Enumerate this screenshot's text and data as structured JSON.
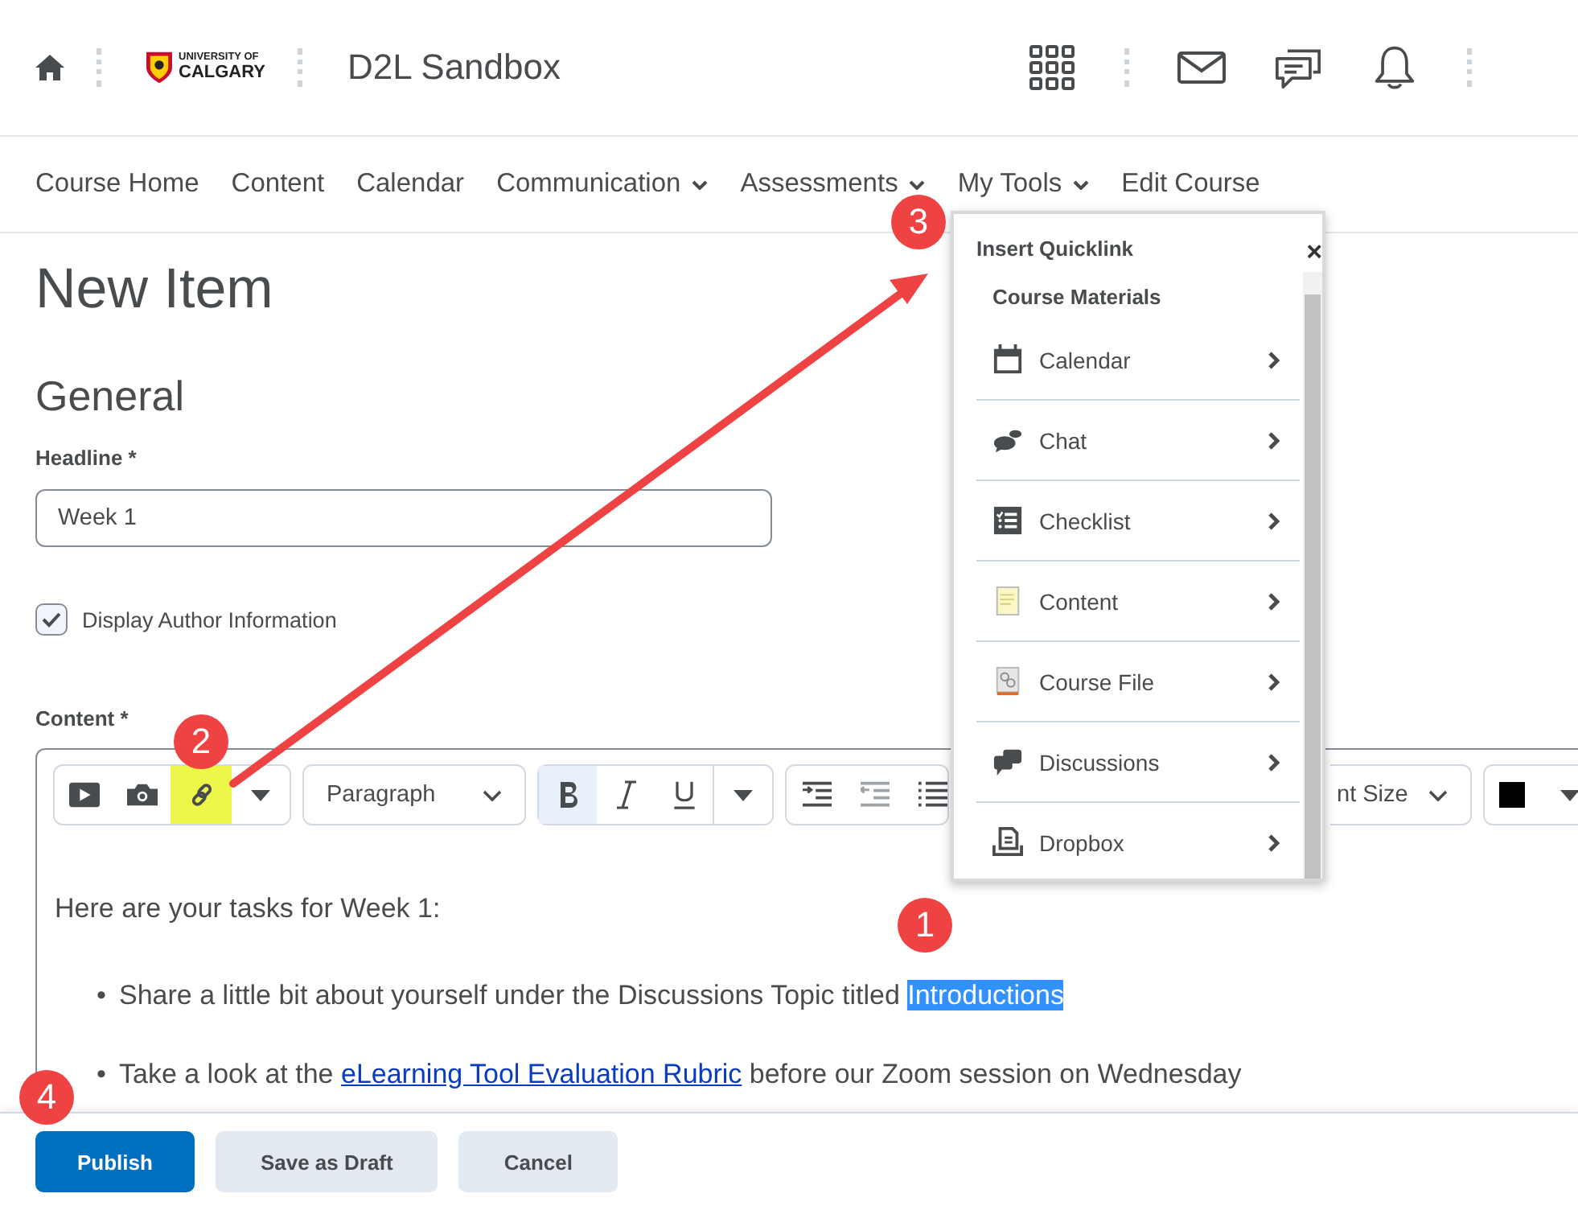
{
  "header": {
    "logo": {
      "line_1": "UNIVERSITY OF",
      "line_2": "CALGARY"
    },
    "course_title": "D2L Sandbox"
  },
  "nav": [
    {
      "label": "Course Home",
      "has_menu": false
    },
    {
      "label": "Content",
      "has_menu": false
    },
    {
      "label": "Calendar",
      "has_menu": false
    },
    {
      "label": "Communication",
      "has_menu": true
    },
    {
      "label": "Assessments",
      "has_menu": true
    },
    {
      "label": "My Tools",
      "has_menu": true
    },
    {
      "label": "Edit Course",
      "has_menu": false
    }
  ],
  "page_title": "New Item",
  "section_title": "General",
  "headline": {
    "label": "Headline *",
    "value": "Week 1"
  },
  "display_author": {
    "label": "Display Author Information",
    "checked": true
  },
  "content_label": "Content *",
  "toolbar": {
    "insert_tools": [
      {
        "kind": "video",
        "highlighted": false
      },
      {
        "kind": "image",
        "highlighted": false
      },
      {
        "kind": "link",
        "highlighted": true
      },
      {
        "kind": "more",
        "highlighted": false
      }
    ],
    "block_format": "Paragraph",
    "format_tools": [
      {
        "kind": "bold",
        "selected": true
      },
      {
        "kind": "italic",
        "selected": false
      },
      {
        "kind": "underline",
        "selected": false
      },
      {
        "kind": "more",
        "selected": false
      }
    ],
    "font_size": "nt Size"
  },
  "editor": {
    "intro": "Here are your tasks for Week 1:",
    "bullets": [
      {
        "marker": "•",
        "parts": [
          {
            "kind": "plain",
            "text": "Share a little bit about yourself under the Discussions Topic titled "
          },
          {
            "kind": "selection",
            "text": "Introductions"
          }
        ]
      },
      {
        "marker": "•",
        "parts": [
          {
            "kind": "plain",
            "text": "Take a look at the "
          },
          {
            "kind": "link",
            "text": "eLearning Tool Evaluation Rubric"
          },
          {
            "kind": "plain",
            "text": " before our Zoom session on Wednesday"
          }
        ]
      }
    ]
  },
  "quicklink": {
    "title": "Insert Quicklink",
    "close": "×",
    "section": "Course Materials",
    "items": [
      "Calendar",
      "Chat",
      "Checklist",
      "Content",
      "Course File",
      "Discussions",
      "Dropbox"
    ]
  },
  "buttons": [
    {
      "label": "Publish",
      "kind": "primary"
    },
    {
      "label": "Save as Draft",
      "kind": "secondary"
    },
    {
      "label": "Cancel",
      "kind": "secondary"
    }
  ],
  "annotations": [
    {
      "label": "1"
    },
    {
      "label": "2"
    },
    {
      "label": "3"
    },
    {
      "label": "4"
    }
  ]
}
